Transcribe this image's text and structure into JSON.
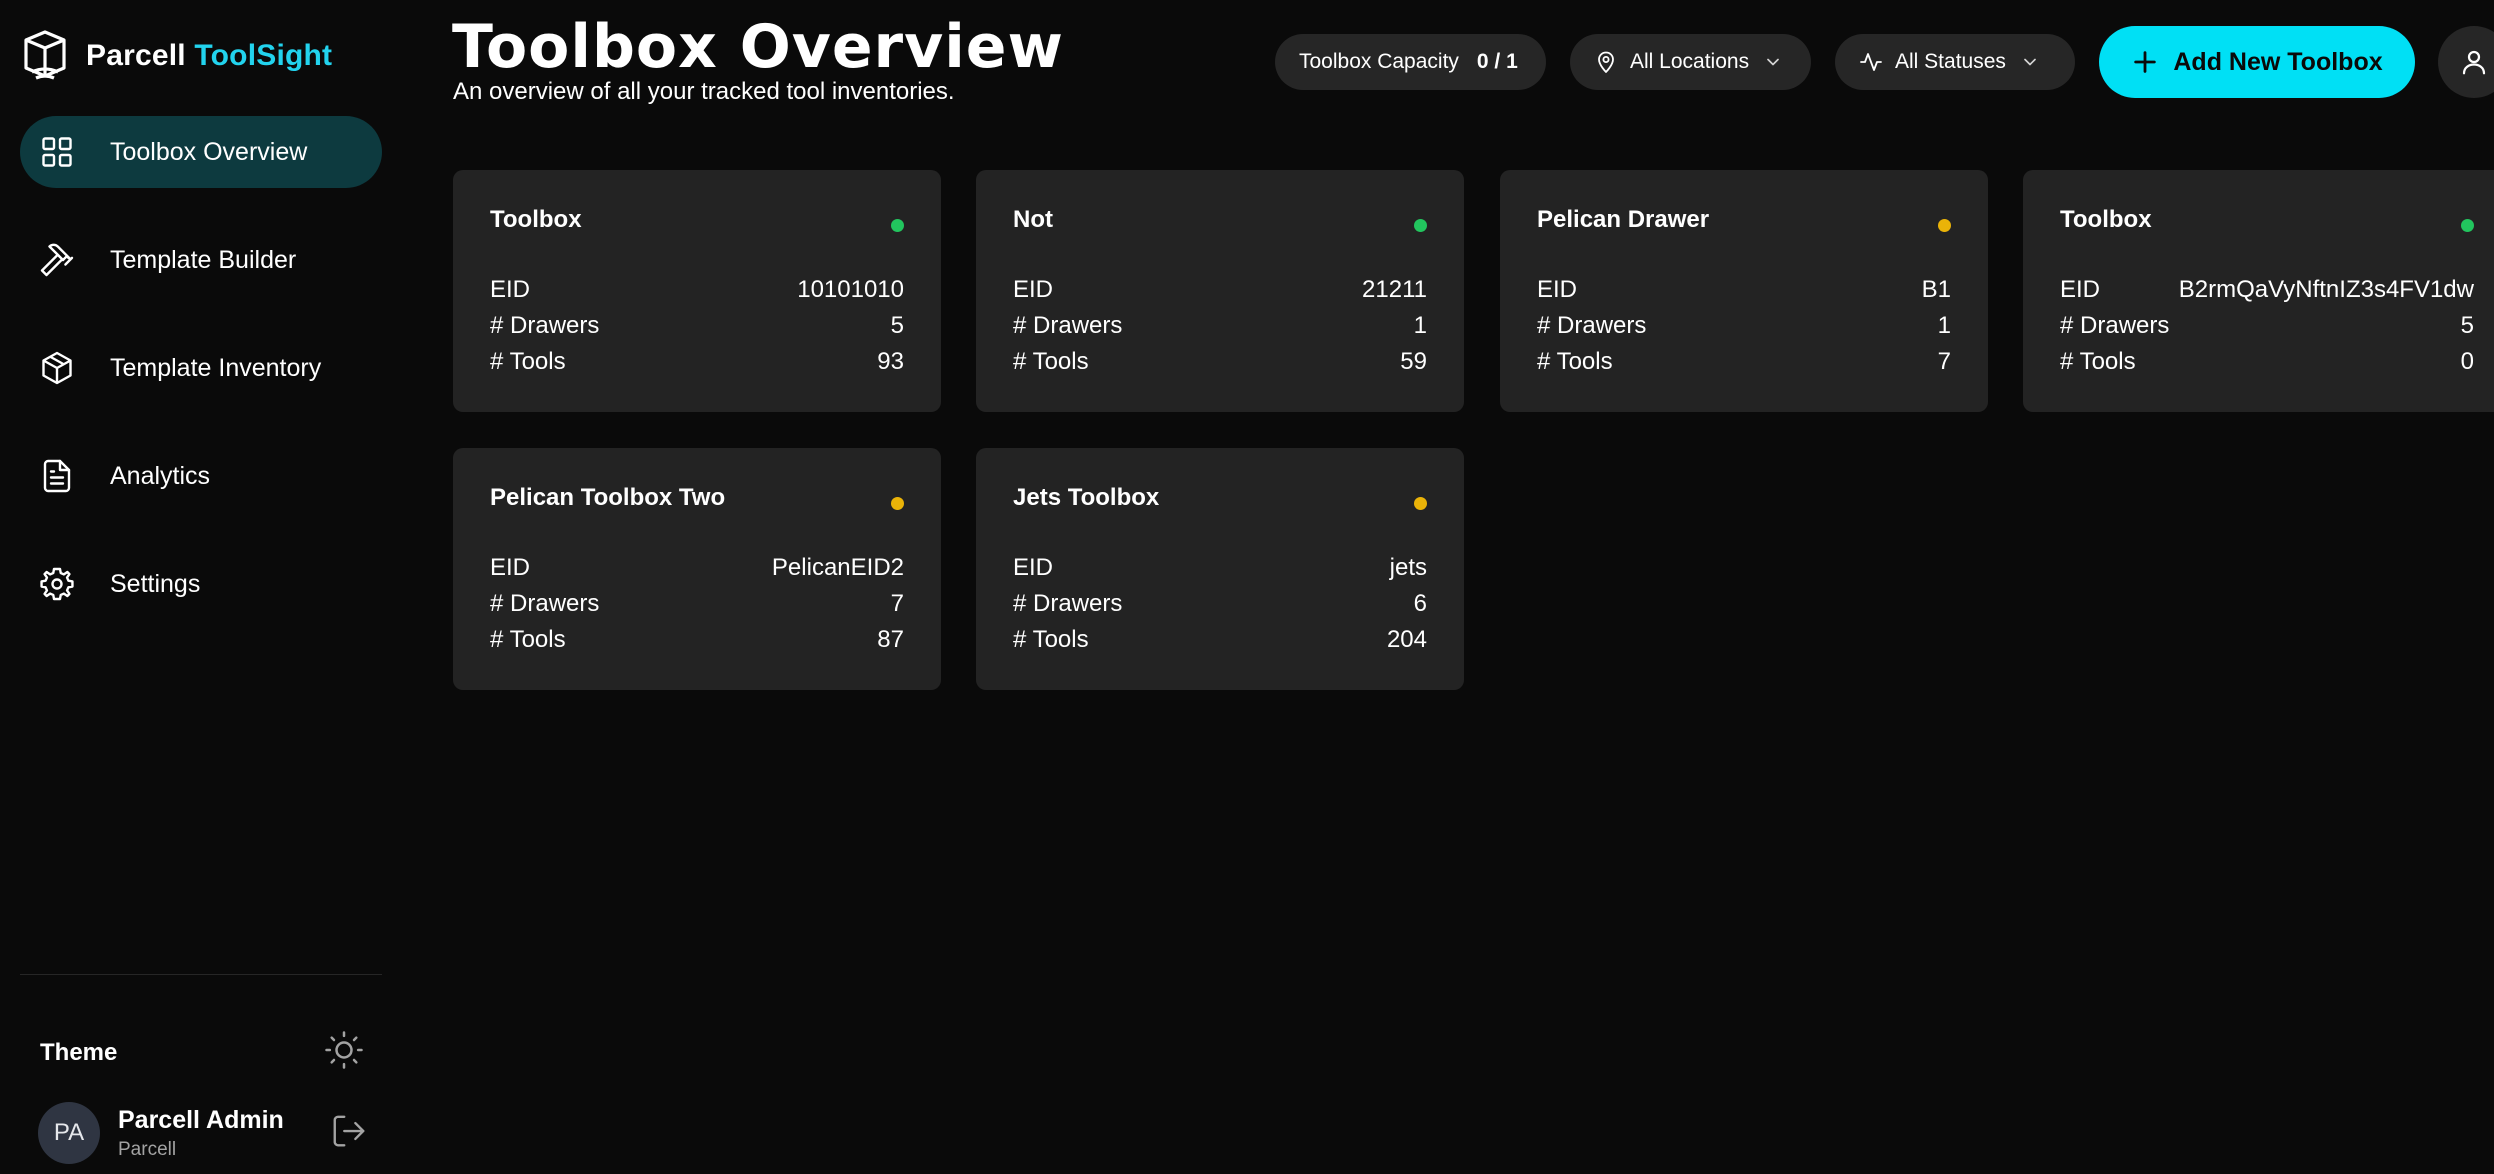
{
  "brand": {
    "name": "Parcell",
    "product": "ToolSight"
  },
  "sidebar": {
    "items": [
      {
        "label": "Toolbox Overview",
        "icon": "grid-icon",
        "active": true
      },
      {
        "label": "Template Builder",
        "icon": "hammer-icon",
        "active": false
      },
      {
        "label": "Template Inventory",
        "icon": "box-icon",
        "active": false
      },
      {
        "label": "Analytics",
        "icon": "document-icon",
        "active": false
      },
      {
        "label": "Settings",
        "icon": "gear-icon",
        "active": false
      }
    ],
    "theme_label": "Theme",
    "user": {
      "initials": "PA",
      "name": "Parcell Admin",
      "org": "Parcell"
    }
  },
  "header": {
    "title": "Toolbox Overview",
    "subtitle": "An overview of all your tracked tool inventories.",
    "capacity_label": "Toolbox Capacity",
    "capacity_value": "0 / 1",
    "locations_label": "All Locations",
    "statuses_label": "All Statuses",
    "add_button_label": "Add New Toolbox"
  },
  "colors": {
    "accent": "#22d3ee",
    "status_green": "#22c55e",
    "status_yellow": "#eab308"
  },
  "field_labels": {
    "eid": "EID",
    "drawers": "# Drawers",
    "tools": "# Tools"
  },
  "toolboxes": [
    {
      "name": "Toolbox",
      "eid": "10101010",
      "drawers": "5",
      "tools": "93",
      "status": "green"
    },
    {
      "name": "Not",
      "eid": "21211",
      "drawers": "1",
      "tools": "59",
      "status": "green"
    },
    {
      "name": "Pelican Drawer",
      "eid": "B1",
      "drawers": "1",
      "tools": "7",
      "status": "yellow"
    },
    {
      "name": "Toolbox",
      "eid": "B2rmQaVyNftnIZ3s4FV1dw",
      "drawers": "5",
      "tools": "0",
      "status": "green"
    },
    {
      "name": "Pelican Toolbox Two",
      "eid": "PelicanEID2",
      "drawers": "7",
      "tools": "87",
      "status": "yellow"
    },
    {
      "name": "Jets Toolbox",
      "eid": "jets",
      "drawers": "6",
      "tools": "204",
      "status": "yellow"
    }
  ]
}
